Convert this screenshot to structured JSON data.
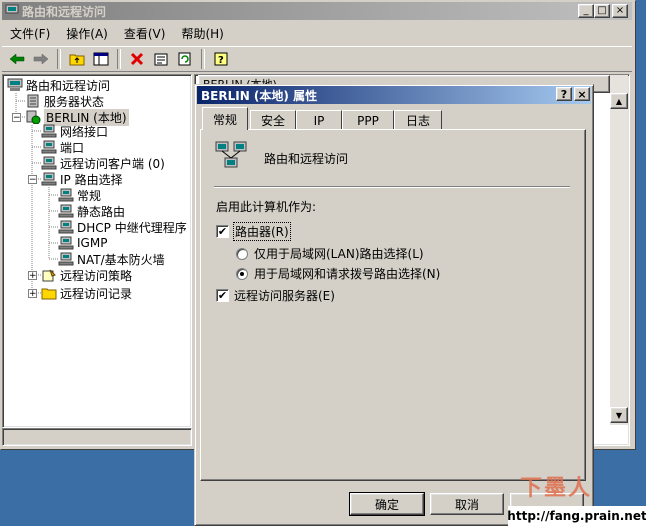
{
  "main_window": {
    "title": "路由和远程访问",
    "caption_buttons": [
      "_",
      "□",
      "×"
    ]
  },
  "menu": [
    "文件(F)",
    "操作(A)",
    "查看(V)",
    "帮助(H)"
  ],
  "toolbar_icons": [
    "back-arrow-icon",
    "forward-arrow-icon",
    "up-folder-icon",
    "show-tree-icon",
    "delete-icon",
    "properties-icon",
    "refresh-icon",
    "help-icon"
  ],
  "tree": {
    "root": "路由和远程访问",
    "server_status": "服务器状态",
    "server": "BERLIN (本地)",
    "network_interfaces": "网络接口",
    "ports": "端口",
    "remote_clients": "远程访问客户端 (0)",
    "ip_routing": "IP 路由选择",
    "general": "常规",
    "static_routes": "静态路由",
    "dhcp_relay": "DHCP 中继代理程序",
    "igmp": "IGMP",
    "nat": "NAT/基本防火墙",
    "policies": "远程访问策略",
    "logging": "远程访问记录"
  },
  "right_pane": {
    "column_header": "BERLIN (本地)"
  },
  "dialog": {
    "title": "BERLIN (本地) 属性",
    "tabs": [
      "常规",
      "安全",
      "IP",
      "PPP",
      "日志"
    ],
    "selected_tab": "常规",
    "heading": "路由和远程访问",
    "enable_label": "启用此计算机作为:",
    "router_label": "路由器(R)",
    "router_checked": true,
    "lan_only_label": "仅用于局域网(LAN)路由选择(L)",
    "lan_dial_label": "用于局域网和请求拨号路由选择(N)",
    "lan_dial_selected": true,
    "ras_label": "远程访问服务器(E)",
    "ras_checked": true,
    "ok": "确定",
    "cancel": "取消",
    "help_button": "?",
    "close_button": "×"
  },
  "watermark": {
    "logo": "下墨人",
    "url": "http://fang.prain.net"
  }
}
